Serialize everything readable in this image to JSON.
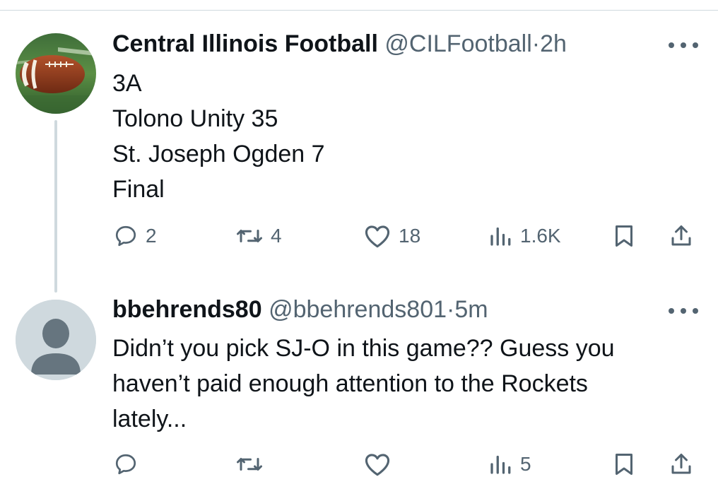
{
  "tweet": {
    "author_name": "Central Illinois Football",
    "handle": "@CILFootball",
    "separator": "·",
    "time": "2h",
    "lines": [
      "3A",
      "Tolono Unity 35",
      "St. Joseph Ogden 7",
      "Final"
    ],
    "stats": {
      "replies": "2",
      "retweets": "4",
      "likes": "18",
      "views": "1.6K"
    }
  },
  "reply": {
    "author_name": "bbehrends80",
    "handle": "@bbehrends801",
    "separator": "·",
    "time": "5m",
    "lines": [
      "Didn’t you pick SJ-O in this game?? Guess you",
      "haven’t paid enough attention to the Rockets",
      "lately..."
    ],
    "stats": {
      "views": "5"
    }
  },
  "icons": [
    "more-icon",
    "reply-icon",
    "retweet-icon",
    "like-icon",
    "views-icon",
    "bookmark-icon",
    "share-icon",
    "default-avatar-icon"
  ],
  "colors": {
    "text": "#0f1419",
    "secondary": "#536471",
    "divider": "#cfd9de"
  }
}
